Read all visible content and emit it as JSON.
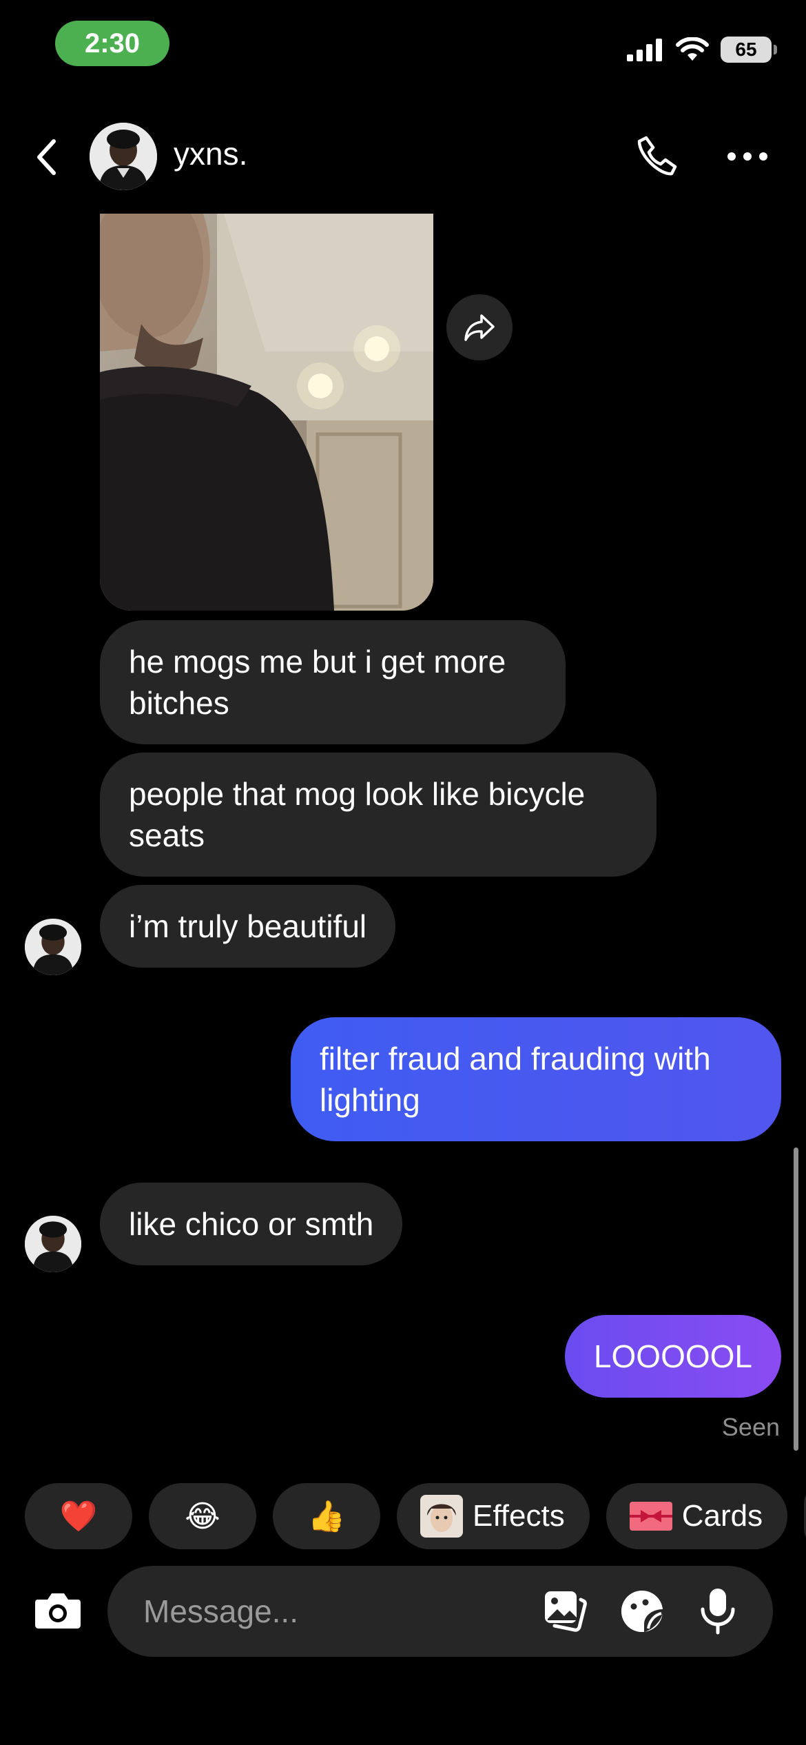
{
  "status": {
    "time": "2:30",
    "battery": "65"
  },
  "header": {
    "name": "yxns."
  },
  "messages": [
    {
      "text": "he mogs me but i get more bitches"
    },
    {
      "text": "people that mog look like bicycle seats"
    },
    {
      "text": "i’m truly beautiful"
    },
    {
      "text": "filter fraud and frauding with lighting"
    },
    {
      "text": "like chico or smth"
    },
    {
      "text": "LOOOOOL"
    }
  ],
  "seen": "Seen",
  "quick_reactions": {
    "emojis": [
      "❤️",
      "😂",
      "👍"
    ],
    "effects_label": "Effects",
    "cards_label": "Cards"
  },
  "composer": {
    "placeholder": "Message..."
  },
  "colors": {
    "outgoing_bubble": "#4c57f0",
    "outgoing_bubble_end": "#7b4cf2",
    "incoming_bubble": "#262626",
    "status_pill": "#4caf50"
  }
}
